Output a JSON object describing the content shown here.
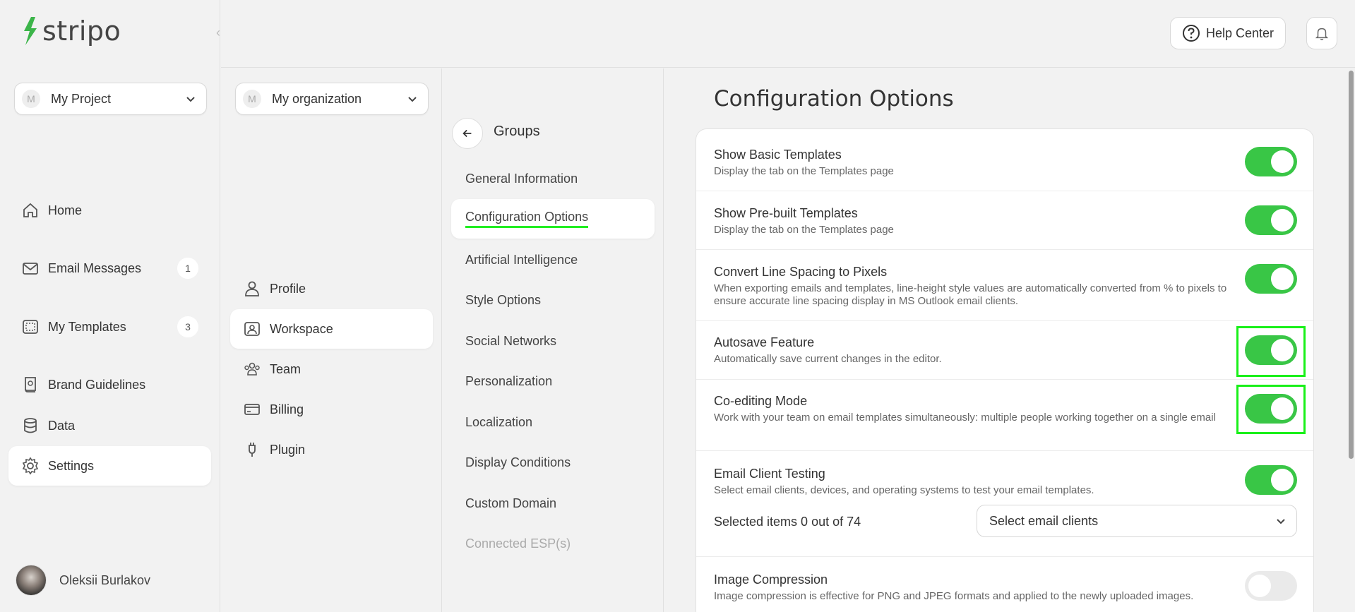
{
  "app": {
    "logo_text": "stripo"
  },
  "project": {
    "avatar": "M",
    "name": "My Project"
  },
  "sidebar": {
    "items": [
      {
        "label": "Home",
        "icon": "home-icon"
      },
      {
        "label": "Email Messages",
        "icon": "mail-icon",
        "badge": "1"
      },
      {
        "label": "My Templates",
        "icon": "templates-icon",
        "badge": "3"
      },
      {
        "label": "Brand Guidelines",
        "icon": "book-icon"
      },
      {
        "label": "Data",
        "icon": "database-icon"
      },
      {
        "label": "Settings",
        "icon": "gear-icon"
      }
    ],
    "active": "Settings"
  },
  "user": {
    "name": "Oleksii Burlakov"
  },
  "header": {
    "help_label": "Help Center"
  },
  "organization": {
    "avatar": "M",
    "name": "My organization"
  },
  "workspace_nav": {
    "items": [
      {
        "label": "Profile",
        "icon": "user-icon"
      },
      {
        "label": "Workspace",
        "icon": "workspace-icon"
      },
      {
        "label": "Team",
        "icon": "team-icon"
      },
      {
        "label": "Billing",
        "icon": "card-icon"
      },
      {
        "label": "Plugin",
        "icon": "plug-icon"
      }
    ],
    "active": "Workspace"
  },
  "groups": {
    "title": "Groups",
    "items": [
      {
        "label": "General Information"
      },
      {
        "label": "Configuration Options"
      },
      {
        "label": "Artificial Intelligence"
      },
      {
        "label": "Style Options"
      },
      {
        "label": "Social Networks"
      },
      {
        "label": "Personalization"
      },
      {
        "label": "Localization"
      },
      {
        "label": "Display Conditions"
      },
      {
        "label": "Custom Domain"
      },
      {
        "label": "Connected ESP(s)"
      }
    ],
    "active": "Configuration Options"
  },
  "main": {
    "title": "Configuration Options",
    "options": [
      {
        "title": "Show Basic Templates",
        "desc": "Display the tab on the Templates page",
        "enabled": true
      },
      {
        "title": "Show Pre-built Templates",
        "desc": "Display the tab on the Templates page",
        "enabled": true
      },
      {
        "title": "Convert Line Spacing to Pixels",
        "desc": "When exporting emails and templates, line-height style values are automatically converted from % to pixels to ensure accurate line spacing display in MS Outlook email clients.",
        "enabled": true
      },
      {
        "title": "Autosave Feature",
        "desc": "Automatically save current changes in the editor.",
        "enabled": true
      },
      {
        "title": "Co-editing Mode",
        "desc": "Work with your team on email templates simultaneously: multiple people working together on a single email",
        "enabled": true
      },
      {
        "title": "Email Client Testing",
        "desc": "Select email clients, devices, and operating systems to test your email templates.",
        "enabled": true
      },
      {
        "title": "Image Compression",
        "desc": "Image compression is effective for PNG and JPEG formats and applied to the newly uploaded images.",
        "enabled": false
      }
    ],
    "email_testing": {
      "selected_text": "Selected items 0 out of 74",
      "select_placeholder": "Select email clients"
    }
  },
  "colors": {
    "accent": "#39c646",
    "highlight": "#19f019",
    "underline": "#22ee22"
  }
}
